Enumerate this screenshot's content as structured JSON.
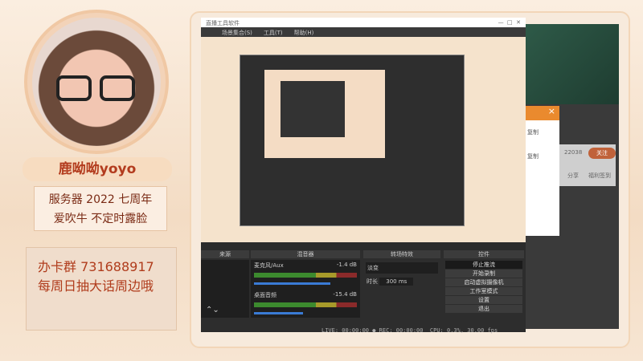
{
  "streamer": {
    "name": "鹿呦呦yoyo",
    "line1": "服务器  2022 七周年",
    "line2": "爱吹牛  不定时露脸",
    "group": "办卡群  731688917",
    "weekly": "每周日抽大话周边哦"
  },
  "obs": {
    "title": "直播工具软件",
    "menu": [
      "场景集合(S)",
      "工具(T)",
      "帮助(H)"
    ],
    "docks": {
      "sources": "来源",
      "mixer": "混音器",
      "transitions": "转场特效",
      "controls": "控件"
    },
    "mixer": [
      {
        "name": "麦克风/Aux",
        "db": "-1.4 dB"
      },
      {
        "name": "桌面音频",
        "db": "-15.4 dB"
      }
    ],
    "transition": {
      "type": "淡变",
      "duration_label": "时长",
      "duration": "300 ms"
    },
    "controls": [
      "停止推流",
      "开始录制",
      "启动虚拟摄像机",
      "工作室模式",
      "设置",
      "退出"
    ],
    "status": {
      "live": "LIVE: 00:00:00",
      "rec": "REC: 00:00:00",
      "cpu": "CPU: 0.3%, 30.00 fps"
    }
  },
  "side": {
    "copy1": "复制",
    "copy2": "复制",
    "count": "22038",
    "follow": "关注",
    "share": "分享",
    "report": "福利签到",
    "close": "×"
  }
}
